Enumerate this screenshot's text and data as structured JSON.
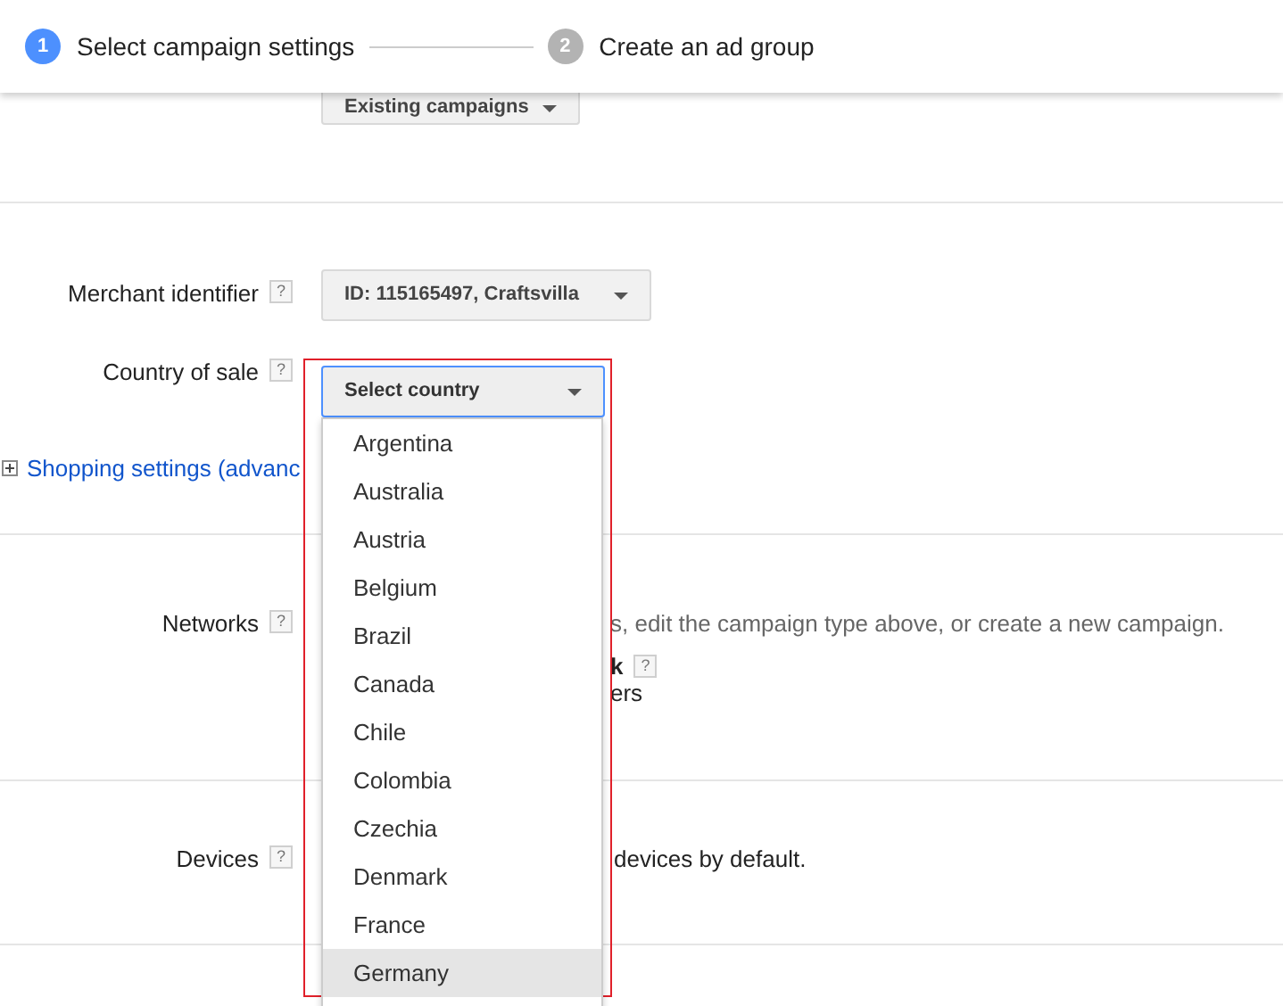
{
  "steps": [
    {
      "number": "1",
      "label": "Select campaign settings",
      "selected": true
    },
    {
      "number": "2",
      "label": "Create an ad group",
      "selected": false
    }
  ],
  "load_settings": {
    "button": "Existing campaigns"
  },
  "merchant": {
    "label": "Merchant identifier",
    "help": "?",
    "value": "ID: 115165497, Craftsvilla"
  },
  "country": {
    "label": "Country of sale",
    "help": "?",
    "value": "Select country",
    "options": [
      {
        "label": "Argentina",
        "selected": false
      },
      {
        "label": "Australia",
        "selected": false
      },
      {
        "label": "Austria",
        "selected": false
      },
      {
        "label": "Belgium",
        "selected": false
      },
      {
        "label": "Brazil",
        "selected": false
      },
      {
        "label": "Canada",
        "selected": false
      },
      {
        "label": "Chile",
        "selected": false
      },
      {
        "label": "Colombia",
        "selected": false
      },
      {
        "label": "Czechia",
        "selected": false
      },
      {
        "label": "Denmark",
        "selected": false
      },
      {
        "label": "France",
        "selected": false
      },
      {
        "label": "Germany",
        "selected": true
      }
    ]
  },
  "shopping_settings": {
    "link": "Shopping settings (advanc"
  },
  "networks": {
    "label": "Networks",
    "help": "?",
    "text": "s, edit the campaign type above, or create a new campaign.",
    "option_fragment": "k",
    "option_help": "?",
    "option_detail_fragment": "ers"
  },
  "devices": {
    "label": "Devices",
    "help": "?",
    "text": "devices by default."
  }
}
